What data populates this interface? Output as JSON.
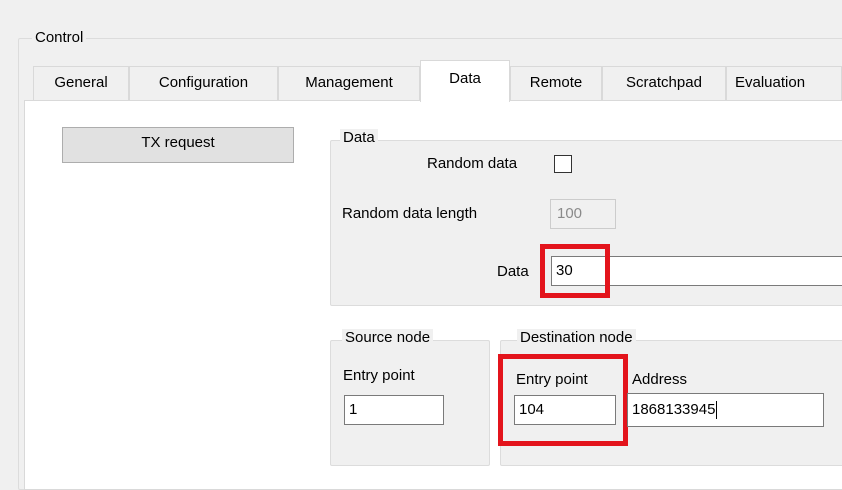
{
  "control": {
    "title": "Control"
  },
  "tabs": [
    {
      "label": "General"
    },
    {
      "label": "Configuration"
    },
    {
      "label": "Management"
    },
    {
      "label": "Data"
    },
    {
      "label": "Remote"
    },
    {
      "label": "Scratchpad"
    },
    {
      "label": "Evaluation"
    }
  ],
  "tx_button": {
    "label": "TX request"
  },
  "data_group": {
    "title": "Data",
    "random_data_label": "Random data",
    "random_data_checked": false,
    "random_length_label": "Random data length",
    "random_length_value": "100",
    "data_label": "Data",
    "data_value": "30"
  },
  "source_node": {
    "title": "Source node",
    "entry_point_label": "Entry point",
    "entry_point_value": "1"
  },
  "destination_node": {
    "title": "Destination node",
    "entry_point_label": "Entry point",
    "entry_point_value": "104",
    "address_label": "Address",
    "address_value": "1868133945"
  },
  "highlight_color": "#e3141c"
}
